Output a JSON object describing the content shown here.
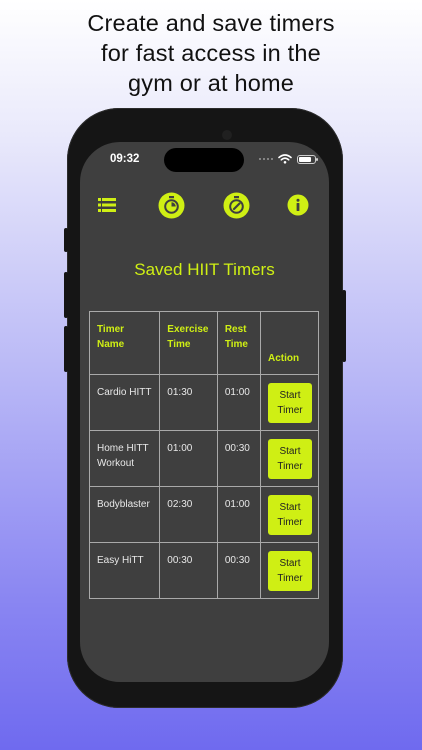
{
  "headline": {
    "line1": "Create and save timers",
    "line2": "for fast access in the",
    "line3": "gym or at home"
  },
  "status_bar": {
    "time": "09:32"
  },
  "toolbar": {
    "icons": [
      "menu-list-icon",
      "stopwatch-icon",
      "timer-edit-icon",
      "info-icon"
    ]
  },
  "page_title": "Saved HIIT Timers",
  "table": {
    "headers": [
      {
        "line1": "Timer",
        "line2": "Name"
      },
      {
        "line1": "Exercise",
        "line2": "Time"
      },
      {
        "line1": "Rest",
        "line2": "Time"
      },
      {
        "line1": "Action",
        "line2": ""
      }
    ],
    "rows": [
      {
        "name1": "Cardio HITT",
        "name2": "",
        "exercise": "01:30",
        "rest": "01:00",
        "action1": "Start",
        "action2": "Timer"
      },
      {
        "name1": "Home HITT",
        "name2": "Workout",
        "exercise": "01:00",
        "rest": "00:30",
        "action1": "Start",
        "action2": "Timer"
      },
      {
        "name1": "Bodyblaster",
        "name2": "",
        "exercise": "02:30",
        "rest": "01:00",
        "action1": "Start",
        "action2": "Timer"
      },
      {
        "name1": "Easy HiTT",
        "name2": "",
        "exercise": "00:30",
        "rest": "00:30",
        "action1": "Start",
        "action2": "Timer"
      }
    ]
  },
  "colors": {
    "accent": "#cfef14",
    "screen_bg": "#3f3f3f",
    "phone_frame": "#151515"
  }
}
